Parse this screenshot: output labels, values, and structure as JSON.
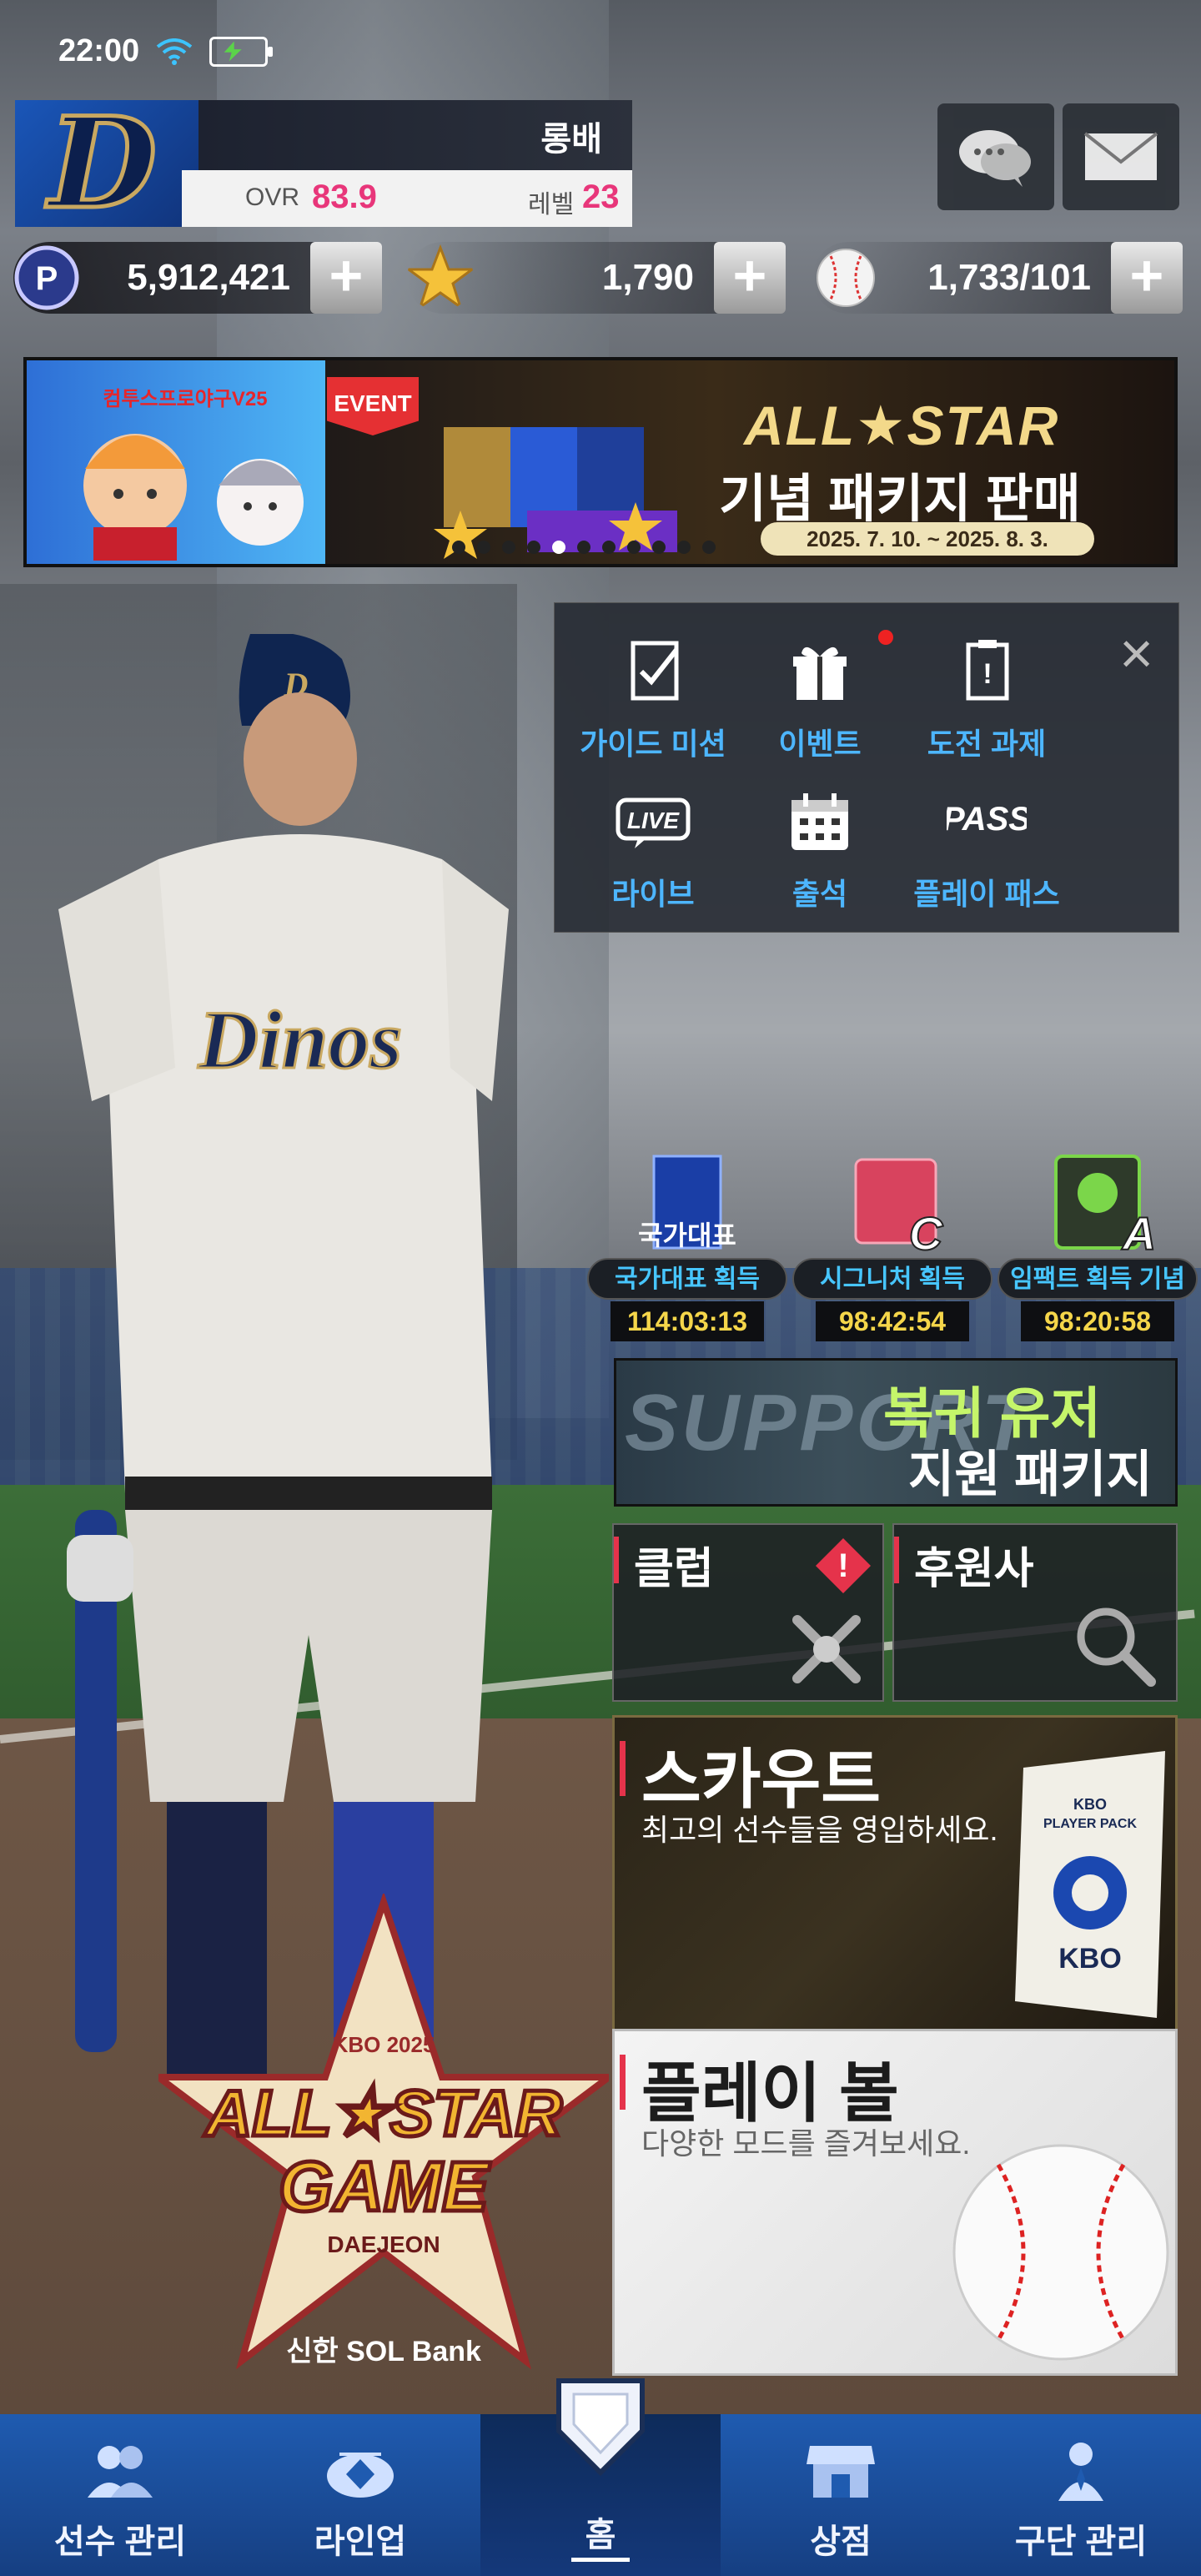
{
  "status_bar": {
    "time": "22:00"
  },
  "profile": {
    "name": "롱배",
    "ovr_label": "OVR",
    "ovr_value": "83.9",
    "level_label": "레벨",
    "level_value": "23"
  },
  "currencies": [
    {
      "icon": "p-point-icon",
      "value": "5,912,421"
    },
    {
      "icon": "star-icon",
      "value": "1,790"
    },
    {
      "icon": "baseball-icon",
      "value": "1,733/101"
    }
  ],
  "banner": {
    "left_title": "컴투스프로야구V25",
    "event_tag": "EVENT",
    "title": "ALL★STAR",
    "subtitle": "기념 패키지 판매",
    "date_range": "2025. 7. 10. ~ 2025. 8. 3.",
    "page_count": 11,
    "active_page": 4
  },
  "quick_menu": {
    "items": [
      {
        "label": "가이드 미션",
        "icon": "guide-mission-icon",
        "notify": false
      },
      {
        "label": "이벤트",
        "icon": "gift-icon",
        "notify": true
      },
      {
        "label": "도전 과제",
        "icon": "challenge-icon",
        "notify": false
      },
      {
        "label": "라이브",
        "icon": "live-icon",
        "notify": false,
        "badge": "LIVE"
      },
      {
        "label": "출석",
        "icon": "calendar-icon",
        "notify": false
      },
      {
        "label": "플레이 패스",
        "icon": "pass-icon",
        "notify": false,
        "badge": "PASS"
      }
    ]
  },
  "timed_events": [
    {
      "art_text": "국가대표",
      "label": "국가대표 획득",
      "time": "114:03:13"
    },
    {
      "art_text": "C",
      "label": "시그니처 획득",
      "time": "98:42:54"
    },
    {
      "art_text": "A",
      "label": "임팩트 획득 기념",
      "time": "98:20:58"
    }
  ],
  "support_banner": {
    "bg_word": "SUPPORT",
    "title": "복귀 유저",
    "subtitle": "지원 패키지"
  },
  "cards": {
    "club": {
      "title": "클럽",
      "alert": "!"
    },
    "sponsor": {
      "title": "후원사"
    },
    "scout": {
      "title": "스카우트",
      "subtitle": "최고의 선수들을 영입하세요.",
      "pack_line1": "KBO",
      "pack_line2": "PLAYER PACK",
      "pack_brand": "KBO"
    },
    "play_ball": {
      "title": "플레이 볼",
      "subtitle": "다양한 모드를 즐겨보세요."
    }
  },
  "player": {
    "jersey_text": "Dinos",
    "helmet_letter": "D"
  },
  "allstar_logo": {
    "top": "KBO 2025",
    "line1": "ALL★STAR",
    "line2": "GAME",
    "city": "DAEJEON",
    "sponsor": "신한 SOL Bank"
  },
  "nav": [
    {
      "label": "선수 관리",
      "icon": "players-icon"
    },
    {
      "label": "라인업",
      "icon": "stadium-icon"
    },
    {
      "label": "홈",
      "icon": "home-plate-icon",
      "active": true
    },
    {
      "label": "상점",
      "icon": "shop-icon"
    },
    {
      "label": "구단 관리",
      "icon": "manager-icon"
    }
  ],
  "colors": {
    "accent_pink": "#e8367a",
    "label_blue": "#47c6ff",
    "timer_yellow": "#f5d64a",
    "nav_blue": "#1f5bb0",
    "card_red_bar": "#e5334b"
  }
}
